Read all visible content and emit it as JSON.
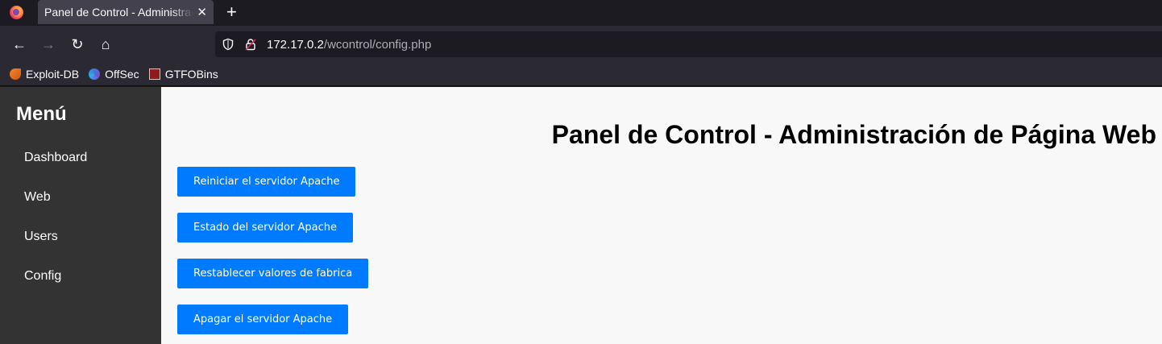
{
  "browser": {
    "tab": {
      "title": "Panel de Control - Administración de Página Web",
      "close_glyph": "✕"
    },
    "new_tab_glyph": "+",
    "nav": {
      "back_glyph": "←",
      "forward_glyph": "→",
      "reload_glyph": "↻",
      "home_glyph": "⌂"
    },
    "url": {
      "host": "172.17.0.2",
      "path": "/wcontrol/config.php"
    },
    "bookmarks": [
      {
        "label": "Exploit-DB",
        "icon": "exploit-db-icon"
      },
      {
        "label": "OffSec",
        "icon": "offsec-icon"
      },
      {
        "label": "GTFOBins",
        "icon": "gtfobins-icon"
      }
    ]
  },
  "sidebar": {
    "title": "Menú",
    "items": [
      {
        "label": "Dashboard"
      },
      {
        "label": "Web"
      },
      {
        "label": "Users"
      },
      {
        "label": "Config"
      }
    ]
  },
  "main": {
    "title": "Panel de Control - Administración de Página Web",
    "buttons": [
      {
        "label": "Reiniciar el servidor Apache"
      },
      {
        "label": "Estado del servidor Apache"
      },
      {
        "label": "Restablecer valores de fabrica"
      },
      {
        "label": "Apagar el servidor Apache"
      }
    ]
  },
  "colors": {
    "button_bg": "#007bff",
    "sidebar_bg": "#333333",
    "page_bg": "#f8f8f8"
  }
}
